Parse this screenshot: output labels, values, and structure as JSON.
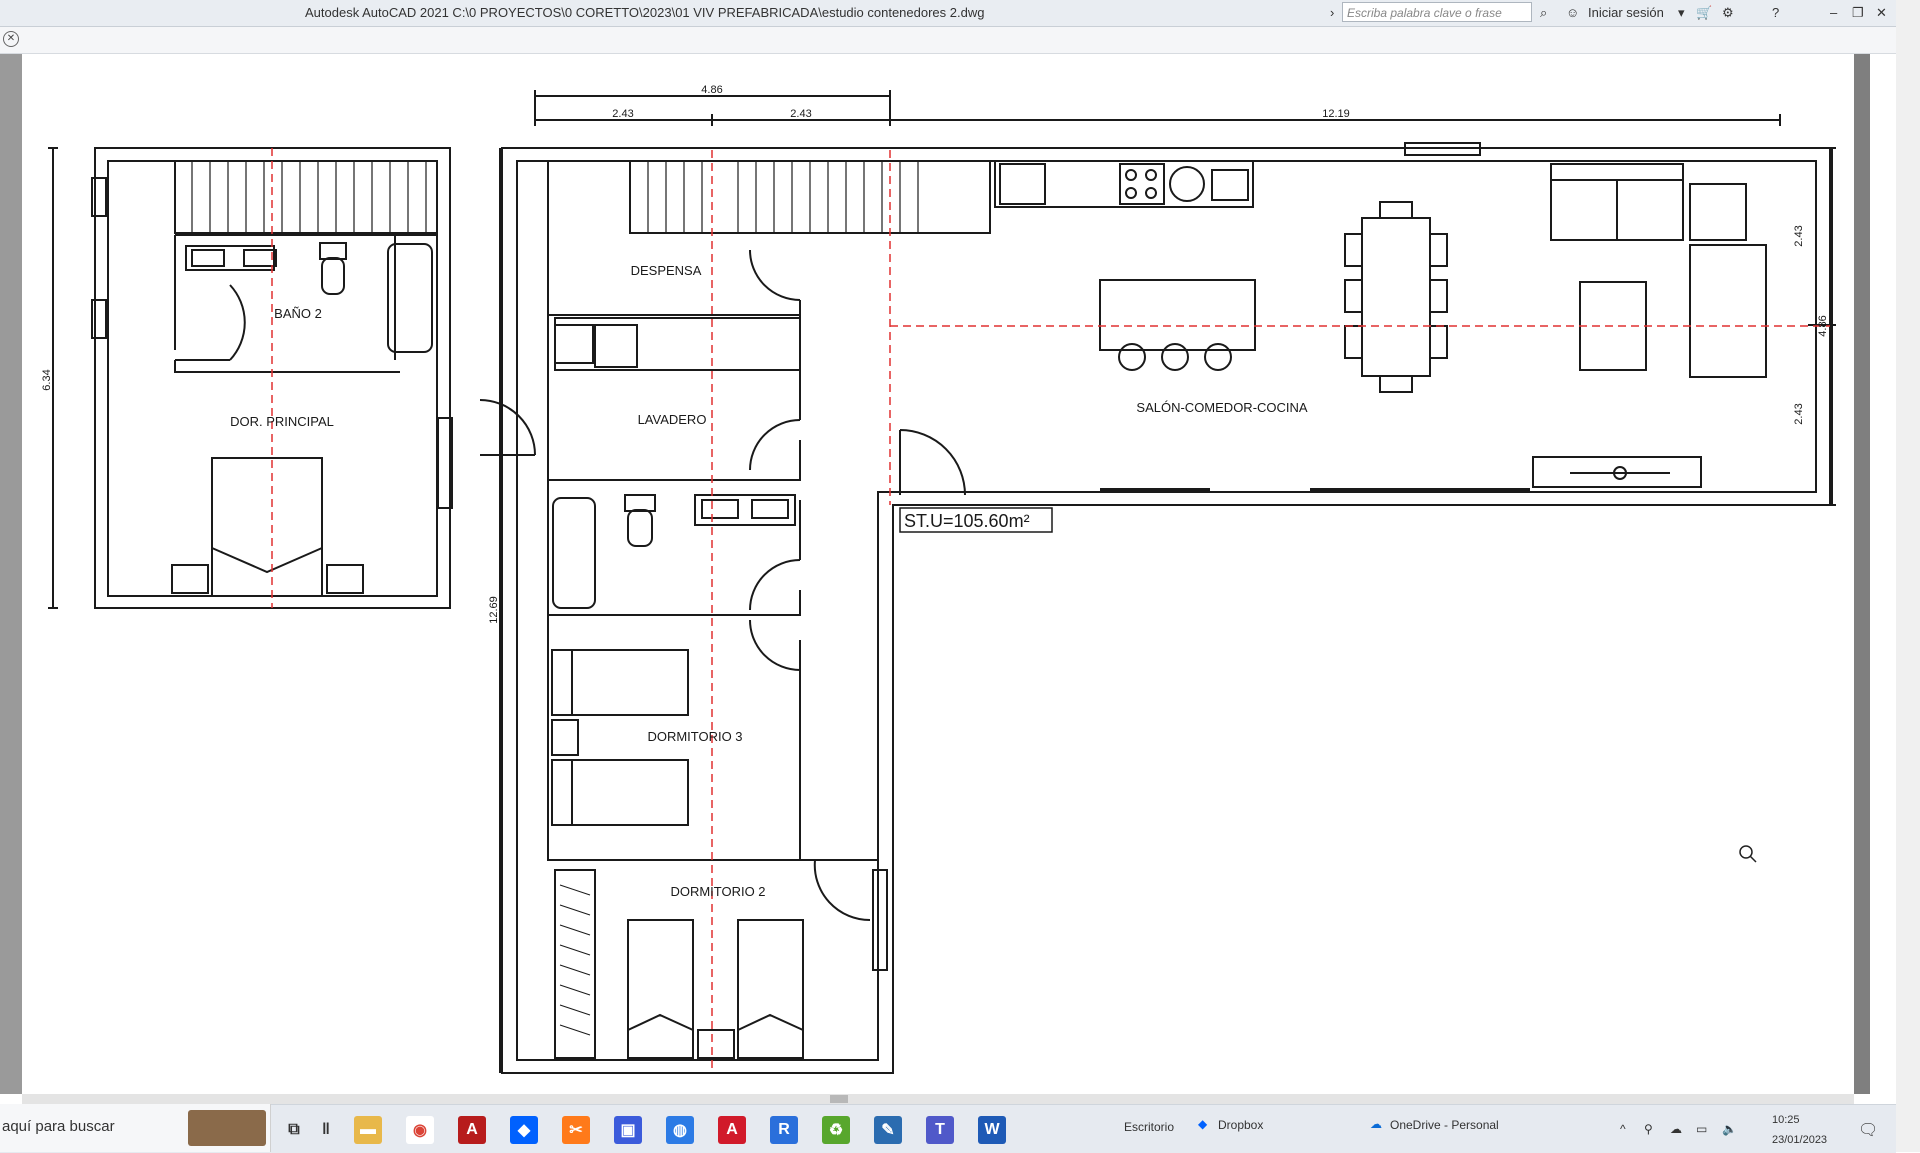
{
  "window": {
    "title": "Autodesk AutoCAD 2021    C:\\0 PROYECTOS\\0 CORETTO\\2023\\01 VIV PREFABRICADA\\estudio contenedores 2.dwg",
    "search_placeholder": "Escriba palabra clave o frase",
    "signin_label": "Iniciar sesión"
  },
  "plan": {
    "rooms": {
      "bath2": "BAÑO 2",
      "master": "DOR. PRINCIPAL",
      "pantry": "DESPENSA",
      "laundry": "LAVADERO",
      "bed3": "DORMITORIO 3",
      "bed2": "DORMITORIO 2",
      "living": "SALÓN-COMEDOR-COCINA"
    },
    "area_label": "ST.U=105.60m²",
    "dims": {
      "total_width_left": "4.86",
      "half_a": "2.43",
      "half_b": "2.43",
      "long_width": "12.19",
      "upper_height": "6.34",
      "long_height": "12.69",
      "right_total": "4.86",
      "right_top": "2.43",
      "right_bottom": "2.43"
    }
  },
  "taskbar": {
    "search_text": "aquí para buscar",
    "desktop_label": "Escritorio",
    "dropbox_label": "Dropbox",
    "onedrive_label": "OneDrive - Personal",
    "time": "10:25",
    "date": "23/01/2023"
  },
  "colors": {
    "wall": "#1a1a1a",
    "axis_line": "#e03030",
    "titlebar_bg": "#e9edf2",
    "taskbar_bg": "#e6eaf0"
  }
}
